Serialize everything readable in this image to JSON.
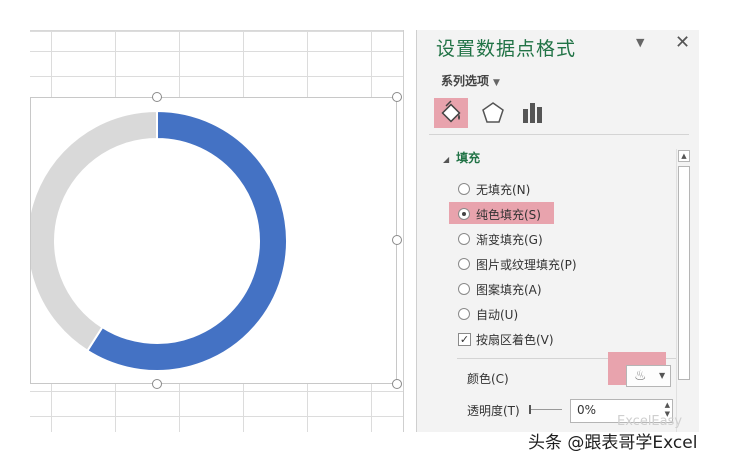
{
  "pane": {
    "title": "设置数据点格式",
    "series_options_label": "系列选项",
    "fill_section_label": "填充",
    "fill_options": [
      {
        "label": "无填充(N)",
        "selected": false
      },
      {
        "label": "纯色填充(S)",
        "selected": true
      },
      {
        "label": "渐变填充(G)",
        "selected": false
      },
      {
        "label": "图片或纹理填充(P)",
        "selected": false
      },
      {
        "label": "图案填充(A)",
        "selected": false
      },
      {
        "label": "自动(U)",
        "selected": false
      }
    ],
    "vary_by_slice": {
      "label": "按扇区着色(V)",
      "checked": true
    },
    "color_label": "颜色(C)",
    "transparency_label": "透明度(T)",
    "transparency_value": "0%"
  },
  "icons": {
    "fill_tab": "paint-bucket-icon",
    "effects_tab": "pentagon-icon",
    "series_options_tab": "bar-chart-icon",
    "color_swatch": "paint-bucket-icon"
  },
  "chart_data": {
    "type": "pie",
    "series": [
      {
        "values": [
          59,
          41
        ],
        "colors": [
          "#4472c4",
          "#d9d9d9"
        ]
      }
    ]
  },
  "colors": {
    "accent_green": "#217346",
    "highlight": "#e8a3ad",
    "donut_blue": "#4472c4",
    "donut_gray": "#d9d9d9"
  },
  "watermark": {
    "text": "头条 @跟表哥学Excel",
    "faint_text": "ExcelEasy"
  }
}
